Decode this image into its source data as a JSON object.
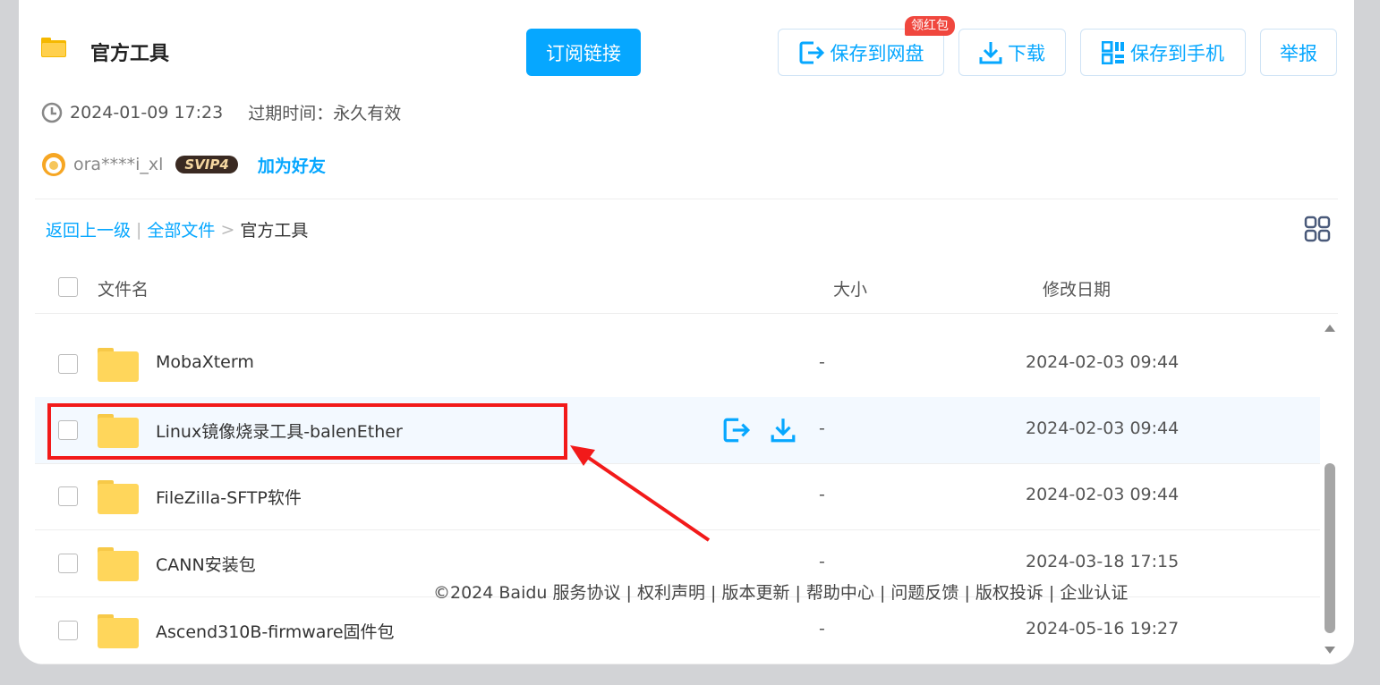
{
  "header": {
    "title": "官方工具",
    "subscribe_label": "订阅链接",
    "save_label": "保存到网盘",
    "download_label": "下载",
    "phone_label": "保存到手机",
    "report_label": "举报",
    "redbag_label": "领红包"
  },
  "meta": {
    "timestamp": "2024-01-09 17:23",
    "expire": "过期时间：永久有效"
  },
  "user": {
    "name": "ora****i_xl",
    "badge": "SVIP4",
    "add_friend": "加为好友"
  },
  "breadcrumb": {
    "back": "返回上一级",
    "all": "全部文件",
    "sep": ">",
    "current": "官方工具",
    "divider": "|"
  },
  "table": {
    "headers": [
      "文件名",
      "大小",
      "修改日期"
    ],
    "rows": [
      {
        "name": "MobaXterm",
        "size": "-",
        "date": "2024-02-03 09:44"
      },
      {
        "name": "Linux镜像烧录工具-balenEther",
        "size": "-",
        "date": "2024-02-03 09:44"
      },
      {
        "name": "FileZilla-SFTP软件",
        "size": "-",
        "date": "2024-02-03 09:44"
      },
      {
        "name": "CANN安装包",
        "size": "-",
        "date": "2024-03-18 17:15"
      },
      {
        "name": "Ascend310B-firmware固件包",
        "size": "-",
        "date": "2024-05-16 19:27"
      }
    ]
  },
  "footer": {
    "text": "©2024 Baidu  服务协议 | 权利声明 | 版本更新 | 帮助中心 | 问题反馈 | 版权投诉 | 企业认证"
  },
  "colors": {
    "accent": "#06a7ff",
    "annotation": "#f21a1a"
  }
}
